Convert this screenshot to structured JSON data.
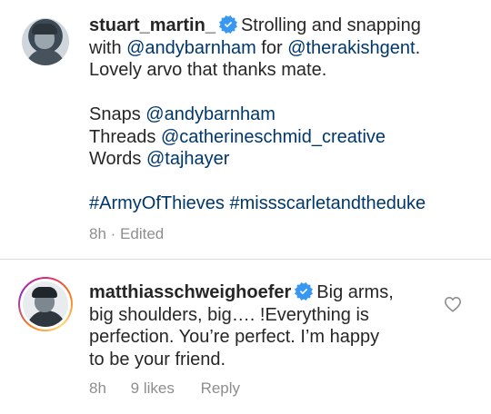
{
  "comments": [
    {
      "username": "stuart_martin_",
      "verified": true,
      "lines": [
        {
          "parts": [
            {
              "t": "Strolling and snapping",
              "link": false
            }
          ]
        },
        {
          "parts": [
            {
              "t": "with ",
              "link": false
            },
            {
              "t": "@andybarnham",
              "link": true
            },
            {
              "t": " for ",
              "link": false
            },
            {
              "t": "@therakishgent",
              "link": true
            },
            {
              "t": ".",
              "link": false
            }
          ]
        },
        {
          "parts": [
            {
              "t": "Lovely arvo that thanks mate.",
              "link": false
            }
          ]
        },
        {
          "parts": []
        },
        {
          "parts": [
            {
              "t": "Snaps ",
              "link": false
            },
            {
              "t": "@andybarnham",
              "link": true
            }
          ]
        },
        {
          "parts": [
            {
              "t": "Threads ",
              "link": false
            },
            {
              "t": "@catherineschmid_creative",
              "link": true
            }
          ]
        },
        {
          "parts": [
            {
              "t": "Words ",
              "link": false
            },
            {
              "t": "@tajhayer",
              "link": true
            }
          ]
        },
        {
          "parts": []
        },
        {
          "parts": [
            {
              "t": "#ArmyOfThieves",
              "link": true
            },
            {
              "t": " ",
              "link": false
            },
            {
              "t": "#missscarletandtheduke",
              "link": true
            }
          ]
        }
      ],
      "time": "8h",
      "edited_label": "Edited"
    },
    {
      "username": "matthiasschweighoefer",
      "verified": true,
      "lines": [
        {
          "parts": [
            {
              "t": "Big arms,",
              "link": false
            }
          ]
        },
        {
          "parts": [
            {
              "t": "big shoulders, big…. !Everything is",
              "link": false
            }
          ]
        },
        {
          "parts": [
            {
              "t": "perfection. You’re perfect. I’m happy",
              "link": false
            }
          ]
        },
        {
          "parts": [
            {
              "t": "to be your friend.",
              "link": false
            }
          ]
        }
      ],
      "time": "8h",
      "likes": "9 likes",
      "reply_label": "Reply"
    }
  ],
  "colors": {
    "link": "#00376b",
    "verified": "#3897f0",
    "meta": "#8e8e8e",
    "text": "#262626"
  },
  "icons": {
    "verified": "verified-badge-icon",
    "like": "heart-outline-icon"
  }
}
